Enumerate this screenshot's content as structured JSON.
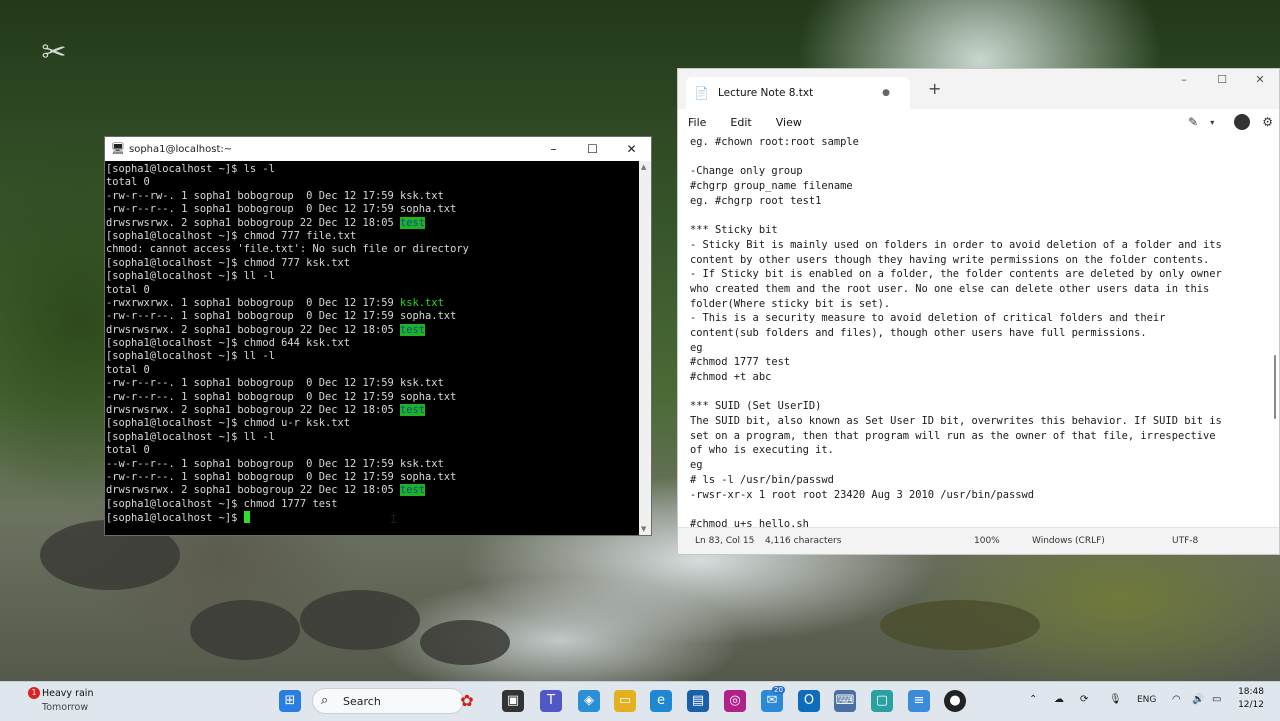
{
  "terminal": {
    "title": "sopha1@localhost:~",
    "controls": [
      "–",
      "☐",
      "✕"
    ],
    "lines": [
      [
        {
          "t": "[sopha1@localhost ~]$ ls -l"
        }
      ],
      [
        {
          "t": "total 0"
        }
      ],
      [
        {
          "t": "-rw-r--rw-. 1 sopha1 bobogroup  0 Dec 12 17:59 ksk.txt"
        }
      ],
      [
        {
          "t": "-rw-r--r--. 1 sopha1 bobogroup  0 Dec 12 17:59 sopha.txt"
        }
      ],
      [
        {
          "t": "drwsrwsrwx. 2 sopha1 bobogroup 22 Dec 12 18:05 "
        },
        {
          "t": "test",
          "c": "hl"
        }
      ],
      [
        {
          "t": "[sopha1@localhost ~]$ chmod 777 file.txt"
        }
      ],
      [
        {
          "t": "chmod: cannot access 'file.txt': No such file or directory"
        }
      ],
      [
        {
          "t": "[sopha1@localhost ~]$ chmod 777 ksk.txt"
        }
      ],
      [
        {
          "t": "[sopha1@localhost ~]$ ll -l"
        }
      ],
      [
        {
          "t": "total 0"
        }
      ],
      [
        {
          "t": "-rwxrwxrwx. 1 sopha1 bobogroup  0 Dec 12 17:59 "
        },
        {
          "t": "ksk.txt",
          "c": "gr"
        }
      ],
      [
        {
          "t": "-rw-r--r--. 1 sopha1 bobogroup  0 Dec 12 17:59 sopha.txt"
        }
      ],
      [
        {
          "t": "drwsrwsrwx. 2 sopha1 bobogroup 22 Dec 12 18:05 "
        },
        {
          "t": "test",
          "c": "hl"
        }
      ],
      [
        {
          "t": "[sopha1@localhost ~]$ chmod 644 ksk.txt"
        }
      ],
      [
        {
          "t": "[sopha1@localhost ~]$ ll -l"
        }
      ],
      [
        {
          "t": "total 0"
        }
      ],
      [
        {
          "t": "-rw-r--r--. 1 sopha1 bobogroup  0 Dec 12 17:59 ksk.txt"
        }
      ],
      [
        {
          "t": "-rw-r--r--. 1 sopha1 bobogroup  0 Dec 12 17:59 sopha.txt"
        }
      ],
      [
        {
          "t": "drwsrwsrwx. 2 sopha1 bobogroup 22 Dec 12 18:05 "
        },
        {
          "t": "test",
          "c": "hl"
        }
      ],
      [
        {
          "t": "[sopha1@localhost ~]$ chmod u-r ksk.txt"
        }
      ],
      [
        {
          "t": "[sopha1@localhost ~]$ ll -l"
        }
      ],
      [
        {
          "t": "total 0"
        }
      ],
      [
        {
          "t": "--w-r--r--. 1 sopha1 bobogroup  0 Dec 12 17:59 ksk.txt"
        }
      ],
      [
        {
          "t": "-rw-r--r--. 1 sopha1 bobogroup  0 Dec 12 17:59 sopha.txt"
        }
      ],
      [
        {
          "t": "drwsrwsrwx. 2 sopha1 bobogroup 22 Dec 12 18:05 "
        },
        {
          "t": "test",
          "c": "hl"
        }
      ],
      [
        {
          "t": "[sopha1@localhost ~]$ chmod 1777 test"
        }
      ],
      [
        {
          "t": "[sopha1@localhost ~]$ "
        },
        {
          "t": "",
          "c": "cursor"
        }
      ]
    ]
  },
  "notepad": {
    "tab_title": "Lecture Note 8.txt",
    "tab_modified_dot": "●",
    "new_tab": "+",
    "controls": [
      "–",
      "☐",
      "✕"
    ],
    "menu": [
      "File",
      "Edit",
      "View"
    ],
    "lines": [
      "eg. #chown root:root sample",
      "",
      "-Change only group",
      "#chgrp group_name filename",
      "eg. #chgrp root test1",
      "",
      "*** Sticky bit",
      "- Sticky Bit is mainly used on folders in order to avoid deletion of a folder and its",
      "content by other users though they having write permissions on the folder contents.",
      "- If Sticky bit is enabled on a folder, the folder contents are deleted by only owner",
      "who created them and the root user. No one else can delete other users data in this",
      "folder(Where sticky bit is set).",
      "- This is a security measure to avoid deletion of critical folders and their",
      "content(sub folders and files), though other users have full permissions.",
      "eg",
      "#chmod 1777 test",
      "#chmod +t abc",
      "",
      "*** SUID (Set UserID)",
      "The SUID bit, also known as Set User ID bit, overwrites this behavior. If SUID bit is",
      "set on a program, then that program will run as the owner of that file, irrespective",
      "of who is executing it.",
      "eg",
      "# ls -l /usr/bin/passwd",
      "-rwsr-xr-x 1 root root 23420 Aug 3 2010 /usr/bin/passwd",
      "",
      "#chmod u+s hello.sh"
    ],
    "status": {
      "position": "Ln 83, Col 15",
      "chars": "4,116 characters",
      "zoom": "100%",
      "line_ending": "Windows (CRLF)",
      "encoding": "UTF-8"
    }
  },
  "taskbar": {
    "weather_badge": "1",
    "weather_title": "Heavy rain",
    "weather_sub": "Tomorrow",
    "search_placeholder": "Search",
    "teams_badge": "20",
    "language": "ENG",
    "time": "18:48",
    "date": "12/12"
  },
  "colors": {
    "terminal_bg": "#000000",
    "terminal_text": "#d8d8d8",
    "dir_highlight": "#1fb41f",
    "exec_green": "#27d827",
    "taskbar_bg": "#dfe6ee"
  }
}
